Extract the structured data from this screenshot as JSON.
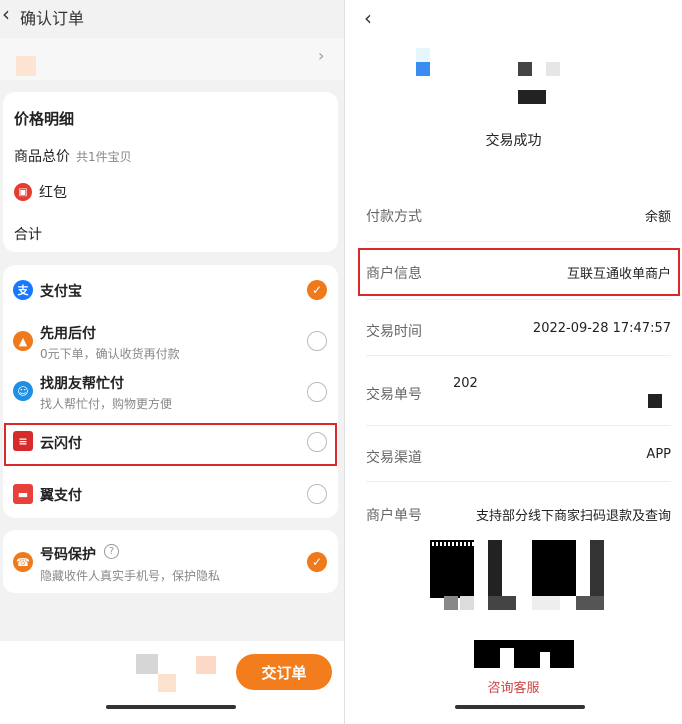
{
  "left": {
    "header": {
      "back_icon": "chevron-left-icon",
      "title": "确认订单"
    },
    "price_card": {
      "heading": "价格明细",
      "goods_total_label": "商品总价",
      "goods_count": "共1件宝贝",
      "hongbao_label": "红包",
      "total_label": "合计"
    },
    "payment_methods": [
      {
        "name": "支付宝",
        "sub": "",
        "icon": "alipay-icon",
        "color": "#1677ff",
        "selected": true
      },
      {
        "name": "先用后付",
        "sub": "0元下单，确认收货再付款",
        "icon": "pay-later-icon",
        "color": "#f07a1a",
        "selected": false
      },
      {
        "name": "找朋友帮忙付",
        "sub": "找人帮忙付，购物更方便",
        "icon": "friend-pay-icon",
        "color": "#1f8fe5",
        "selected": false
      },
      {
        "name": "云闪付",
        "sub": "",
        "icon": "unionpay-icon",
        "color": "#d72b2b",
        "selected": false
      },
      {
        "name": "翼支付",
        "sub": "",
        "icon": "bestpay-icon",
        "color": "#e8403a",
        "selected": false
      }
    ],
    "protect": {
      "title": "号码保护",
      "sub": "隐藏收件人真实手机号，保护隐私",
      "selected": true
    },
    "submit_label": "交订单"
  },
  "right": {
    "back_icon": "chevron-left-icon",
    "status": "交易成功",
    "rows": [
      {
        "label": "付款方式",
        "value": "余额"
      },
      {
        "label": "商户信息",
        "value": "互联互通收单商户"
      },
      {
        "label": "交易时间",
        "value": "2022-09-28 17:47:57"
      },
      {
        "label": "交易单号",
        "value": "202"
      },
      {
        "label": "交易渠道",
        "value": "APP"
      },
      {
        "label": "商户单号",
        "value": "支持部分线下商家扫码退款及查询"
      }
    ],
    "consult_label": "咨询客服"
  },
  "colors": {
    "accent": "#f37c1c",
    "highlight": "#d82a2a"
  }
}
